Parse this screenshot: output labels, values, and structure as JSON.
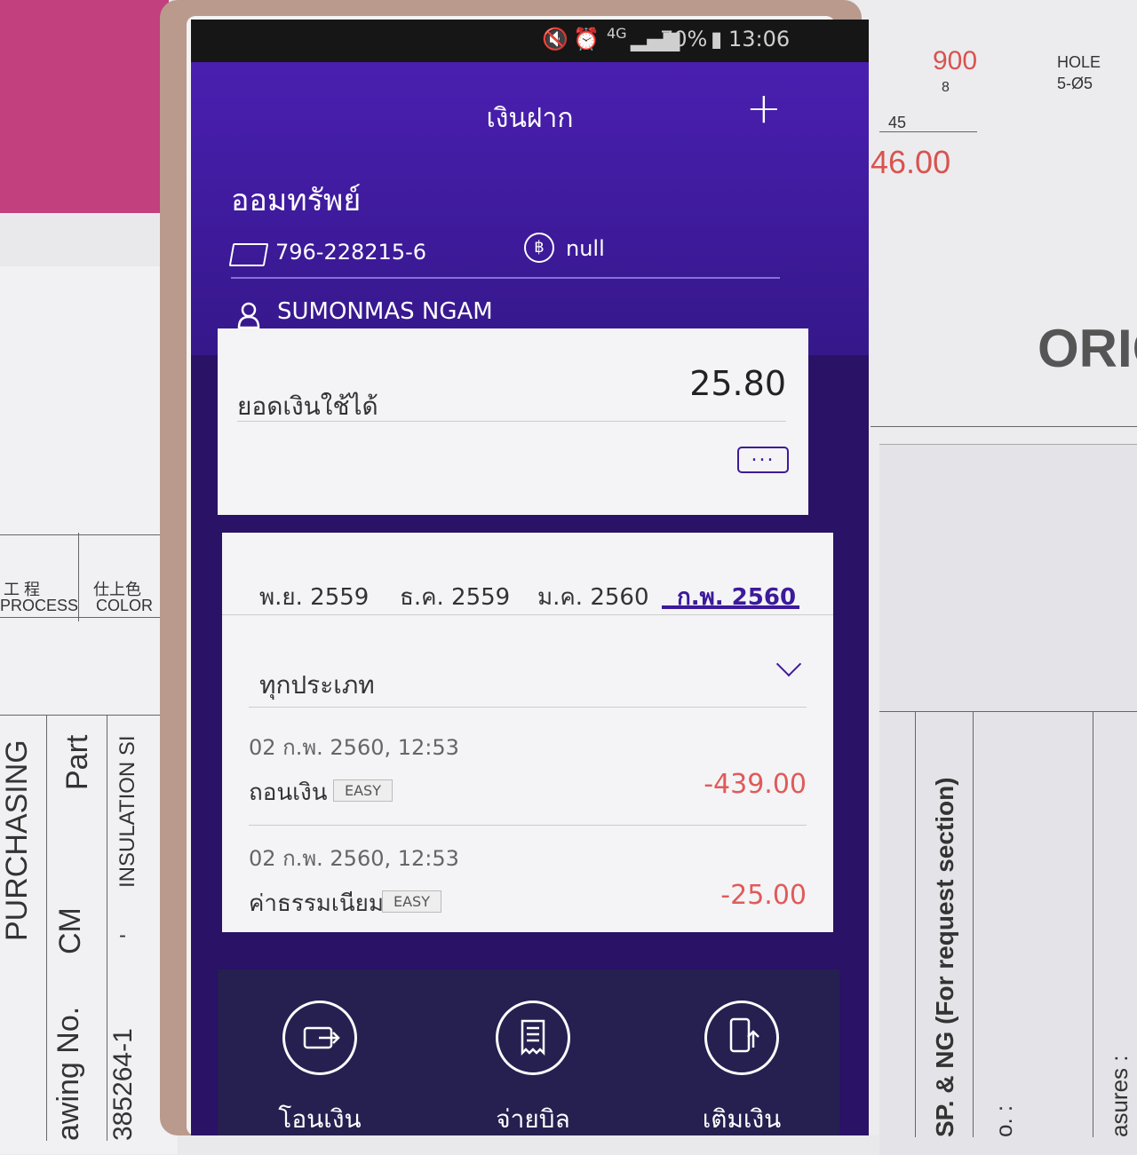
{
  "status_bar": {
    "network": "4G",
    "battery": "70%",
    "time": "13:06"
  },
  "header": {
    "title": "เงินฝาก",
    "add_label": "+",
    "account_type": "ออมทรัพย์",
    "account_number": "796-228215-6",
    "balance_display": "null",
    "owner_name": "SUMONMAS NGAM"
  },
  "balance_card": {
    "label": "ยอดเงินใช้ได้",
    "amount": "25.80",
    "more_label": "..."
  },
  "months": [
    {
      "label": "พ.ย. 2559",
      "active": false
    },
    {
      "label": "ธ.ค. 2559",
      "active": false
    },
    {
      "label": "ม.ค. 2560",
      "active": false
    },
    {
      "label": "ก.พ. 2560",
      "active": true
    }
  ],
  "filter": {
    "label": "ทุกประเภท"
  },
  "transactions": [
    {
      "datetime": "02 ก.พ. 2560, 12:53",
      "description": "ถอนเงิน",
      "badge": "EASY",
      "amount": "-439.00"
    },
    {
      "datetime": "02 ก.พ. 2560, 12:53",
      "description": "ค่าธรรมเนียม",
      "badge": "EASY",
      "amount": "-25.00"
    }
  ],
  "actions": [
    {
      "label": "โอนเงิน",
      "icon": "wallet-transfer-icon"
    },
    {
      "label": "จ่ายบิล",
      "icon": "bill-receipt-icon"
    },
    {
      "label": "เติมเงิน",
      "icon": "phone-topup-icon"
    }
  ],
  "background_docs": {
    "left_process": "工 程",
    "left_process_en": "PROCESS",
    "left_color": "仕上色",
    "left_color_en": "COLOR",
    "purchasing": "PURCHASING",
    "part": "Part",
    "cm": "CM",
    "insulation": "INSULATION SI",
    "dash": "-",
    "drawing_no": "awing No.",
    "drawing_val": "385264-1",
    "right_hole": "HOLE",
    "right_hole_spec": "5-Ø5",
    "right_45": "45",
    "right_8": "8",
    "right_900": "900",
    "right_46": "46.00",
    "right_orig": "ORIG",
    "right_request": "SP. & NG (For request section)",
    "right_o": "o. :",
    "right_measures": "asures :"
  },
  "colors": {
    "header": "#4a1fb0",
    "accent": "#3d1a9a",
    "negative": "#e05a5a",
    "bottom_bar": "#252050"
  }
}
